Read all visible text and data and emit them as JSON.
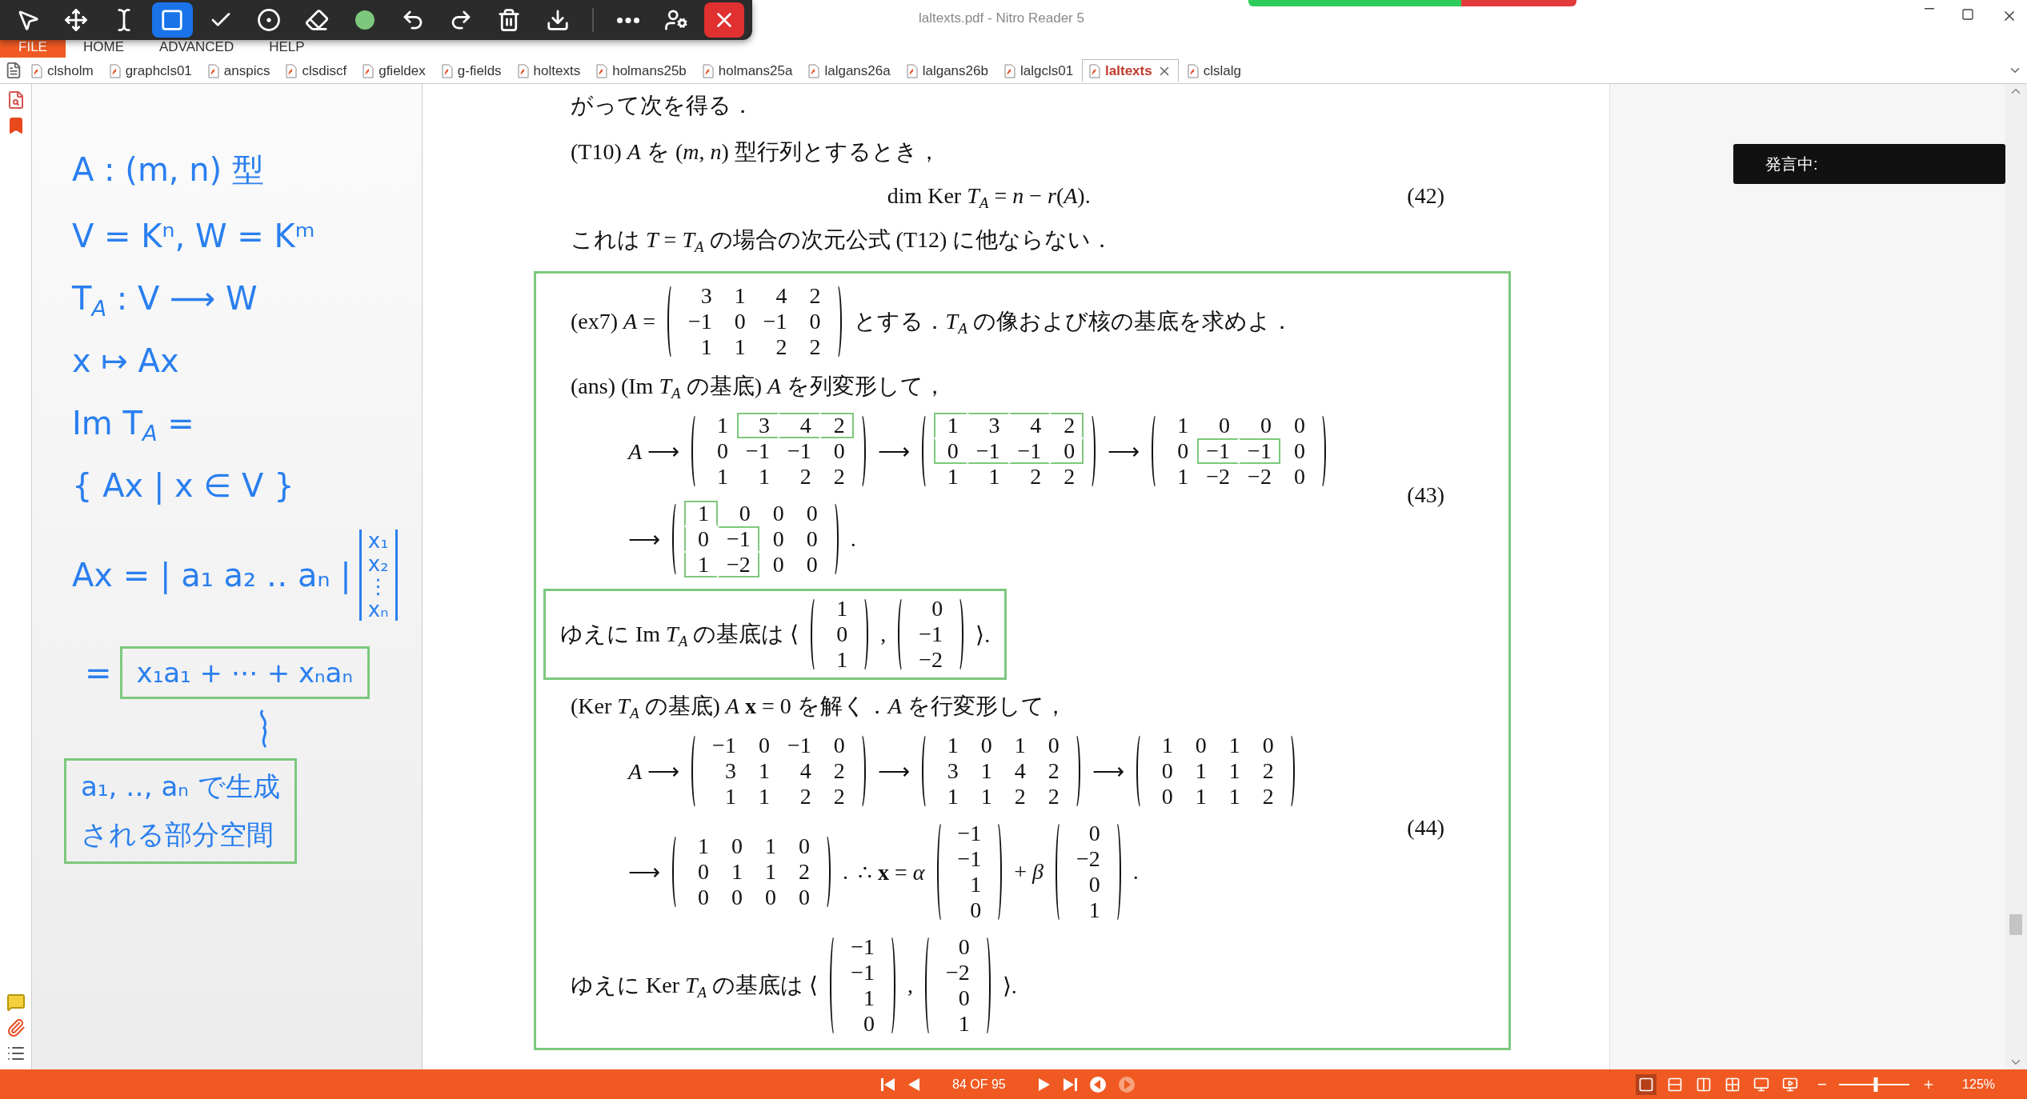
{
  "window": {
    "title": "laltexts.pdf - Nitro Reader 5"
  },
  "quick_toolbar": {
    "tools": [
      {
        "kind": "pointer",
        "selected": false
      },
      {
        "kind": "move",
        "selected": false
      },
      {
        "kind": "text",
        "selected": false
      },
      {
        "kind": "rectangle",
        "selected": true
      },
      {
        "kind": "check",
        "selected": false
      },
      {
        "kind": "record",
        "selected": false
      },
      {
        "kind": "eraser",
        "selected": false
      },
      {
        "kind": "color",
        "selected": false,
        "color": "#7dc87d"
      }
    ],
    "actions": [
      {
        "kind": "undo"
      },
      {
        "kind": "redo"
      },
      {
        "kind": "delete"
      },
      {
        "kind": "download"
      },
      {
        "kind": "separator"
      },
      {
        "kind": "more"
      },
      {
        "kind": "user"
      },
      {
        "kind": "close"
      }
    ]
  },
  "menu": [
    {
      "label": "FILE",
      "selected": true
    },
    {
      "label": "HOME",
      "selected": false
    },
    {
      "label": "ADVANCED",
      "selected": false
    },
    {
      "label": "HELP",
      "selected": false
    }
  ],
  "tabs": [
    {
      "label": "clsholm",
      "selected": false
    },
    {
      "label": "graphcls01",
      "selected": false
    },
    {
      "label": "anspics",
      "selected": false
    },
    {
      "label": "clsdiscf",
      "selected": false
    },
    {
      "label": "gfieldex",
      "selected": false
    },
    {
      "label": "g-fields",
      "selected": false
    },
    {
      "label": "holtexts",
      "selected": false
    },
    {
      "label": "holmans25b",
      "selected": false
    },
    {
      "label": "holmans25a",
      "selected": false
    },
    {
      "label": "lalgans26a",
      "selected": false
    },
    {
      "label": "lalgans26b",
      "selected": false
    },
    {
      "label": "lalgcls01",
      "selected": false
    },
    {
      "label": "laltexts",
      "selected": true
    },
    {
      "label": "clslalg",
      "selected": false
    }
  ],
  "ink_notes": [
    {
      "kind": "text",
      "text": "A : (m, n) 型"
    },
    {
      "kind": "text",
      "text": "V = Kⁿ, W = Kᵐ"
    },
    {
      "kind": "text",
      "text": "T$_{A}$ : V ⟶ W"
    },
    {
      "kind": "text",
      "text": "x ↦ Ax"
    },
    {
      "kind": "text",
      "text": "Im T$_{A}$ ="
    },
    {
      "kind": "text",
      "text": "{ Ax | x ∈ V }"
    },
    {
      "kind": "vector",
      "text": "Ax = | a₁ a₂ ‥ aₙ |",
      "entries": [
        "x₁",
        "x₂",
        "⋮",
        "xₙ"
      ]
    },
    {
      "kind": "boxed",
      "prefix": "=",
      "lines": [
        "x₁a₁ + ⋯ + xₙaₙ"
      ]
    },
    {
      "kind": "brace"
    },
    {
      "kind": "boxed",
      "lines": [
        "a₁, ‥, aₙ で生成",
        "される部分空間"
      ]
    }
  ],
  "page": {
    "blocks": [
      {
        "kind": "paragraph",
        "text": "がって次を得る．"
      },
      {
        "kind": "paragraph",
        "text": "(T10) *A* を (*m*, *n*) 型行列とするとき，"
      },
      {
        "kind": "equation",
        "number": "(42)",
        "lines": [
          {
            "items": [
              {
                "kind": "math",
                "text": "dim Ker *T*$_{A}$ = *n* − *r*(*A*)."
              }
            ]
          }
        ]
      },
      {
        "kind": "paragraph",
        "text": "これは *T* = *T*$_{A}$ の場合の次元公式 (T12) に他ならない．"
      },
      {
        "kind": "framed",
        "blocks": [
          {
            "kind": "line",
            "items": [
              {
                "kind": "math",
                "text": "(ex7) *A* ="
              },
              {
                "kind": "matrix",
                "rows": [
                  [
                    "3",
                    "1",
                    "4",
                    "2"
                  ],
                  [
                    "−1",
                    "0",
                    "−1",
                    "0"
                  ],
                  [
                    "1",
                    "1",
                    "2",
                    "2"
                  ]
                ]
              },
              {
                "kind": "math",
                "text": "とする．*T*$_{A}$ の像および核の基底を求めよ．"
              }
            ]
          },
          {
            "kind": "paragraph",
            "text": "(ans) (Im *T*$_{A}$ の基底) *A* を列変形して，"
          },
          {
            "kind": "equation",
            "number": "(43)",
            "lines": [
              {
                "items": [
                  {
                    "kind": "math",
                    "text": "*A* ⟶"
                  },
                  {
                    "kind": "matrix",
                    "rows": [
                      [
                        "1",
                        "3",
                        "4",
                        "2"
                      ],
                      [
                        "0",
                        "−1",
                        "−1",
                        "0"
                      ],
                      [
                        "1",
                        "1",
                        "2",
                        "2"
                      ]
                    ],
                    "marked": [
                      [
                        false,
                        true,
                        true,
                        true
                      ],
                      [
                        false,
                        false,
                        false,
                        false
                      ],
                      [
                        false,
                        false,
                        false,
                        false
                      ]
                    ]
                  },
                  {
                    "kind": "math",
                    "text": "⟶"
                  },
                  {
                    "kind": "matrix",
                    "rows": [
                      [
                        "1",
                        "3",
                        "4",
                        "2"
                      ],
                      [
                        "0",
                        "−1",
                        "−1",
                        "0"
                      ],
                      [
                        "1",
                        "1",
                        "2",
                        "2"
                      ]
                    ],
                    "marked": [
                      [
                        true,
                        true,
                        true,
                        true
                      ],
                      [
                        true,
                        true,
                        true,
                        true
                      ],
                      [
                        false,
                        false,
                        false,
                        false
                      ]
                    ]
                  },
                  {
                    "kind": "math",
                    "text": "⟶"
                  },
                  {
                    "kind": "matrix",
                    "rows": [
                      [
                        "1",
                        "0",
                        "0",
                        "0"
                      ],
                      [
                        "0",
                        "−1",
                        "−1",
                        "0"
                      ],
                      [
                        "1",
                        "−2",
                        "−2",
                        "0"
                      ]
                    ],
                    "marked": [
                      [
                        false,
                        false,
                        false,
                        false
                      ],
                      [
                        false,
                        true,
                        true,
                        false
                      ],
                      [
                        false,
                        false,
                        false,
                        false
                      ]
                    ]
                  }
                ]
              },
              {
                "items": [
                  {
                    "kind": "math",
                    "text": "⟶"
                  },
                  {
                    "kind": "matrix",
                    "rows": [
                      [
                        "1",
                        "0",
                        "0",
                        "0"
                      ],
                      [
                        "0",
                        "−1",
                        "0",
                        "0"
                      ],
                      [
                        "1",
                        "−2",
                        "0",
                        "0"
                      ]
                    ],
                    "marked": [
                      [
                        true,
                        false,
                        false,
                        false
                      ],
                      [
                        true,
                        true,
                        false,
                        false
                      ],
                      [
                        true,
                        true,
                        false,
                        false
                      ]
                    ]
                  },
                  {
                    "kind": "math",
                    "text": "."
                  }
                ]
              }
            ]
          },
          {
            "kind": "boxed_line",
            "items": [
              {
                "kind": "math",
                "text": "ゆえに Im *T*$_{A}$ の基底は ⟨"
              },
              {
                "kind": "matrix",
                "rows": [
                  [
                    "1"
                  ],
                  [
                    "0"
                  ],
                  [
                    "1"
                  ]
                ]
              },
              {
                "kind": "math",
                "text": ","
              },
              {
                "kind": "matrix",
                "rows": [
                  [
                    "0"
                  ],
                  [
                    "−1"
                  ],
                  [
                    "−2"
                  ]
                ]
              },
              {
                "kind": "math",
                "text": "⟩."
              }
            ]
          },
          {
            "kind": "paragraph",
            "text": "(Ker *T*$_{A}$ の基底) *A* **x** = 0 を解く．*A* を行変形して，"
          },
          {
            "kind": "equation",
            "number": "(44)",
            "lines": [
              {
                "items": [
                  {
                    "kind": "math",
                    "text": "*A* ⟶"
                  },
                  {
                    "kind": "matrix",
                    "rows": [
                      [
                        "−1",
                        "0",
                        "−1",
                        "0"
                      ],
                      [
                        "3",
                        "1",
                        "4",
                        "2"
                      ],
                      [
                        "1",
                        "1",
                        "2",
                        "2"
                      ]
                    ]
                  },
                  {
                    "kind": "math",
                    "text": "⟶"
                  },
                  {
                    "kind": "matrix",
                    "rows": [
                      [
                        "1",
                        "0",
                        "1",
                        "0"
                      ],
                      [
                        "3",
                        "1",
                        "4",
                        "2"
                      ],
                      [
                        "1",
                        "1",
                        "2",
                        "2"
                      ]
                    ]
                  },
                  {
                    "kind": "math",
                    "text": "⟶"
                  },
                  {
                    "kind": "matrix",
                    "rows": [
                      [
                        "1",
                        "0",
                        "1",
                        "0"
                      ],
                      [
                        "0",
                        "1",
                        "1",
                        "2"
                      ],
                      [
                        "0",
                        "1",
                        "1",
                        "2"
                      ]
                    ]
                  }
                ]
              },
              {
                "items": [
                  {
                    "kind": "math",
                    "text": "⟶"
                  },
                  {
                    "kind": "matrix",
                    "rows": [
                      [
                        "1",
                        "0",
                        "1",
                        "0"
                      ],
                      [
                        "0",
                        "1",
                        "1",
                        "2"
                      ],
                      [
                        "0",
                        "0",
                        "0",
                        "0"
                      ]
                    ]
                  },
                  {
                    "kind": "math",
                    "text": "."
                  },
                  {
                    "kind": "math",
                    "text": "∴ **x** = *α*"
                  },
                  {
                    "kind": "matrix",
                    "rows": [
                      [
                        "−1"
                      ],
                      [
                        "−1"
                      ],
                      [
                        "1"
                      ],
                      [
                        "0"
                      ]
                    ]
                  },
                  {
                    "kind": "math",
                    "text": "+ *β*"
                  },
                  {
                    "kind": "matrix",
                    "rows": [
                      [
                        "0"
                      ],
                      [
                        "−2"
                      ],
                      [
                        "0"
                      ],
                      [
                        "1"
                      ]
                    ]
                  },
                  {
                    "kind": "math",
                    "text": "."
                  }
                ]
              }
            ]
          },
          {
            "kind": "line",
            "items": [
              {
                "kind": "math",
                "text": "ゆえに Ker *T*$_{A}$ の基底は ⟨"
              },
              {
                "kind": "matrix",
                "rows": [
                  [
                    "−1"
                  ],
                  [
                    "−1"
                  ],
                  [
                    "1"
                  ],
                  [
                    "0"
                  ]
                ]
              },
              {
                "kind": "math",
                "text": ","
              },
              {
                "kind": "matrix",
                "rows": [
                  [
                    "0"
                  ],
                  [
                    "−2"
                  ],
                  [
                    "0"
                  ],
                  [
                    "1"
                  ]
                ]
              },
              {
                "kind": "math",
                "text": "⟩."
              }
            ]
          }
        ]
      }
    ]
  },
  "overlay": {
    "text": "発言中:"
  },
  "status_bar": {
    "page": "84 OF 95",
    "views": [
      {
        "kind": "single",
        "selected": true
      },
      {
        "kind": "continuous",
        "selected": false
      },
      {
        "kind": "facing",
        "selected": false
      },
      {
        "kind": "facing_continuous",
        "selected": false
      },
      {
        "kind": "presentation",
        "selected": false
      },
      {
        "kind": "fullscreen",
        "selected": false
      }
    ],
    "zoom": {
      "level": 0.52,
      "text": "125%"
    }
  }
}
